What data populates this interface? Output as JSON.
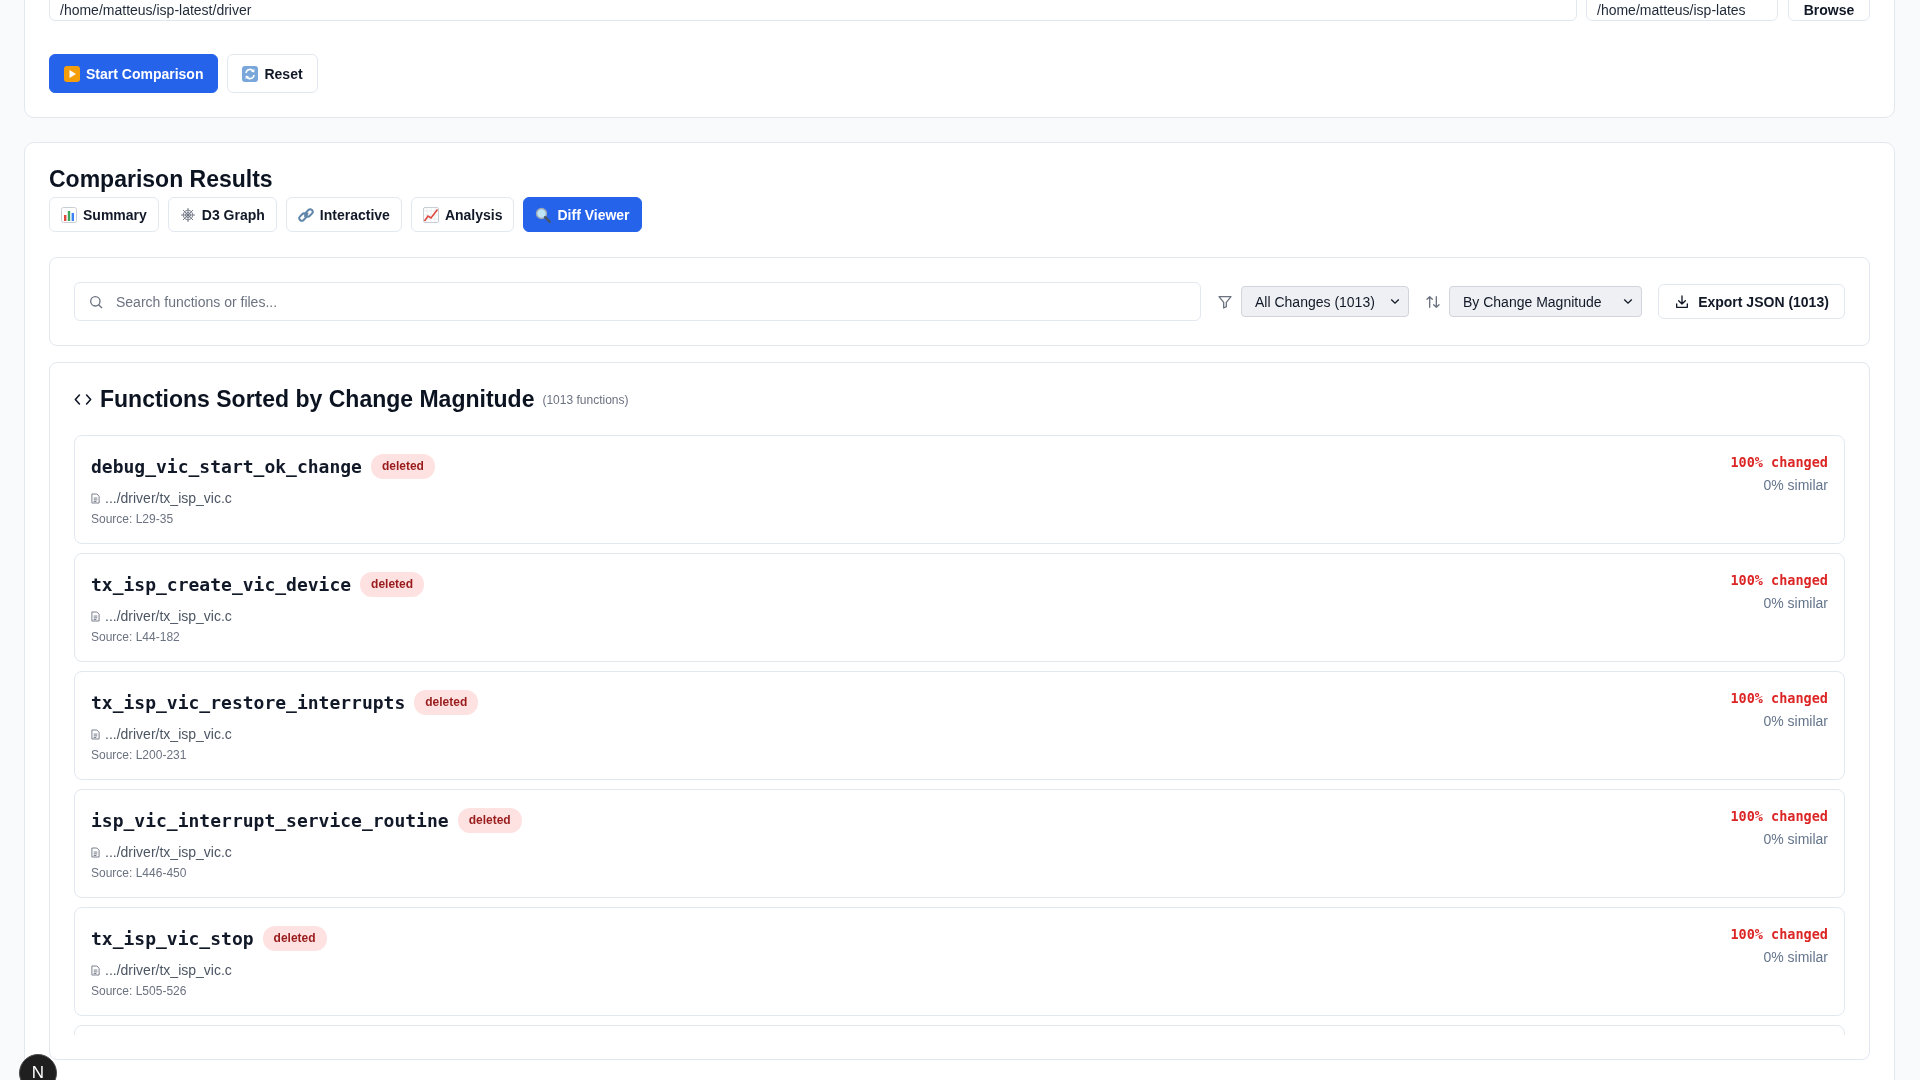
{
  "source_panel": {
    "paths": [
      {
        "value": "/home/matteus/isp-latest/driver"
      },
      {
        "value": "/home/matteus/isp-lates"
      }
    ],
    "browse_button": "Browse",
    "actions": [
      {
        "label": "Start Comparison",
        "kind": "primary"
      },
      {
        "label": "Reset",
        "kind": "secondary"
      }
    ]
  },
  "results": {
    "title": "Comparison Results",
    "tabs": [
      {
        "label": "Summary",
        "selected": false
      },
      {
        "label": "D3 Graph",
        "selected": false
      },
      {
        "label": "Interactive",
        "selected": false
      },
      {
        "label": "Analysis",
        "selected": false
      },
      {
        "label": "Diff Viewer",
        "selected": true
      }
    ],
    "filters": {
      "search": {
        "placeholder": "Search functions or files..."
      },
      "change_filter": "All Changes (1013)",
      "sort": "By Change Magnitude",
      "export_button": "Export JSON (1013)"
    },
    "functions": {
      "title": "Functions Sorted by Change Magnitude",
      "count": "(1013 functions)",
      "items": [
        {
          "name": "debug_vic_start_ok_change",
          "status": "deleted",
          "file": ".../driver/tx_isp_vic.c",
          "source": "Source: L29-35",
          "changed": "100% changed",
          "similar": "0% similar"
        },
        {
          "name": "tx_isp_create_vic_device",
          "status": "deleted",
          "file": ".../driver/tx_isp_vic.c",
          "source": "Source: L44-182",
          "changed": "100% changed",
          "similar": "0% similar"
        },
        {
          "name": "tx_isp_vic_restore_interrupts",
          "status": "deleted",
          "file": ".../driver/tx_isp_vic.c",
          "source": "Source: L200-231",
          "changed": "100% changed",
          "similar": "0% similar"
        },
        {
          "name": "isp_vic_interrupt_service_routine",
          "status": "deleted",
          "file": ".../driver/tx_isp_vic.c",
          "source": "Source: L446-450",
          "changed": "100% changed",
          "similar": "0% similar"
        },
        {
          "name": "tx_isp_vic_stop",
          "status": "deleted",
          "file": ".../driver/tx_isp_vic.c",
          "source": "Source: L505-526",
          "changed": "100% changed",
          "similar": "0% similar"
        }
      ]
    }
  },
  "dev_badge": "N"
}
